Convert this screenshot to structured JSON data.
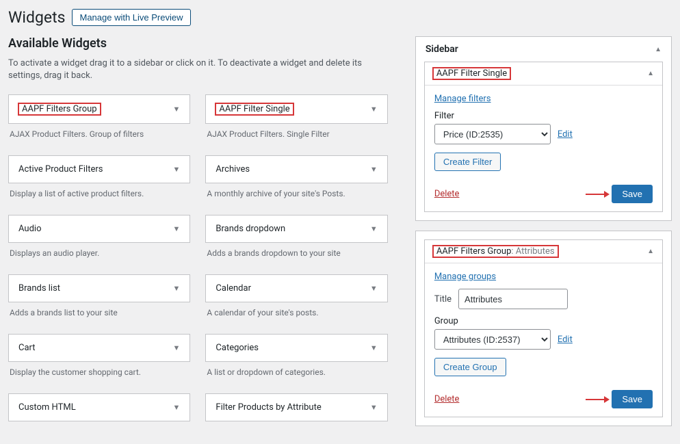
{
  "page": {
    "title": "Widgets",
    "liveButton": "Manage with Live Preview",
    "availableHeading": "Available Widgets",
    "availableDesc": "To activate a widget drag it to a sidebar or click on it. To deactivate a widget and delete its settings, drag it back."
  },
  "widgets": [
    {
      "title": "AAPF Filters Group",
      "desc": "AJAX Product Filters. Group of filters",
      "highlighted": true
    },
    {
      "title": "AAPF Filter Single",
      "desc": "AJAX Product Filters. Single Filter",
      "highlighted": true
    },
    {
      "title": "Active Product Filters",
      "desc": "Display a list of active product filters."
    },
    {
      "title": "Archives",
      "desc": "A monthly archive of your site's Posts."
    },
    {
      "title": "Audio",
      "desc": "Displays an audio player."
    },
    {
      "title": "Brands dropdown",
      "desc": "Adds a brands dropdown to your site"
    },
    {
      "title": "Brands list",
      "desc": "Adds a brands list to your site"
    },
    {
      "title": "Calendar",
      "desc": "A calendar of your site's posts."
    },
    {
      "title": "Cart",
      "desc": "Display the customer shopping cart."
    },
    {
      "title": "Categories",
      "desc": "A list or dropdown of categories."
    },
    {
      "title": "Custom HTML",
      "desc": ""
    },
    {
      "title": "Filter Products by Attribute",
      "desc": ""
    }
  ],
  "sidebar": {
    "title": "Sidebar",
    "widget1": {
      "title": "AAPF Filter Single",
      "manageLink": "Manage filters",
      "filterLabel": "Filter",
      "filterValue": "Price (ID:2535)",
      "editLink": "Edit",
      "createBtn": "Create Filter",
      "deleteLink": "Delete",
      "saveBtn": "Save"
    },
    "widget2": {
      "title": "AAPF Filters Group",
      "subtitle": "Attributes",
      "manageLink": "Manage groups",
      "titleLabel": "Title",
      "titleValue": "Attributes",
      "groupLabel": "Group",
      "groupValue": "Attributes (ID:2537)",
      "editLink": "Edit",
      "createBtn": "Create Group",
      "deleteLink": "Delete",
      "saveBtn": "Save"
    }
  }
}
